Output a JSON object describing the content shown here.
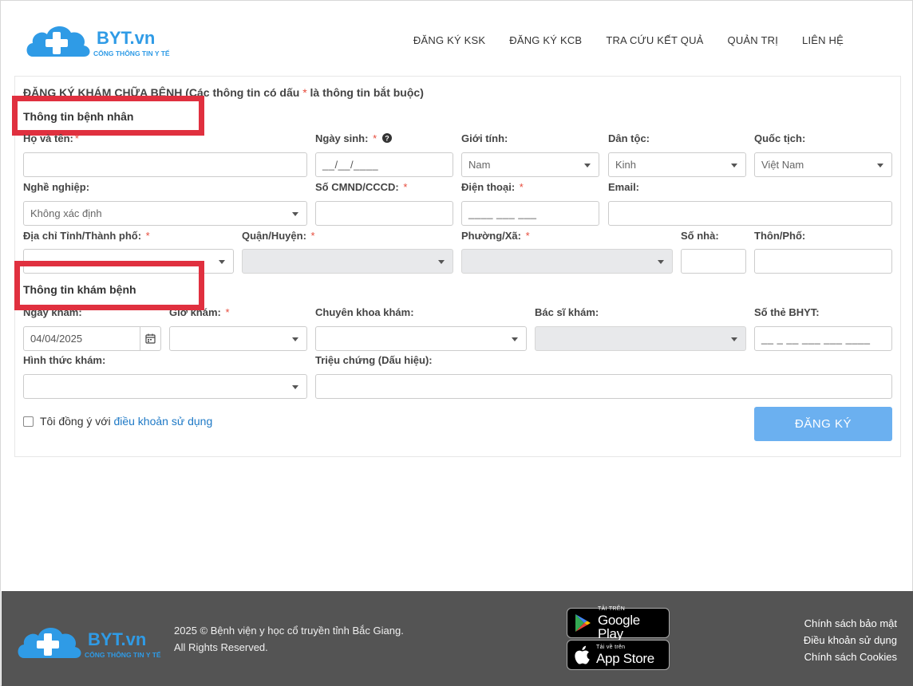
{
  "header": {
    "logo_text": "BYT.vn",
    "logo_tagline": "CỔNG THÔNG TIN Y TẾ",
    "nav": [
      "ĐĂNG KÝ KSK",
      "ĐĂNG KÝ KCB",
      "TRA CỨU KẾT QUẢ",
      "QUẢN TRỊ",
      "LIÊN HỆ"
    ]
  },
  "form": {
    "title_prefix": "ĐĂNG KÝ KHÁM CHỮA BỆNH (Các thông tin có dấu ",
    "title_asterisk": "*",
    "title_suffix": " là thông tin bắt buộc)",
    "patient_section": "Thông tin bệnh nhân",
    "exam_section": "Thông tin khám bệnh",
    "required_mark": "*",
    "labels": {
      "full_name": "Họ và tên:",
      "dob": "Ngày sinh:",
      "gender": "Giới tính:",
      "ethnicity": "Dân tộc:",
      "nationality": "Quốc tịch:",
      "occupation": "Nghề nghiệp:",
      "id_number": "Số CMND/CCCD:",
      "phone": "Điện thoại:",
      "email": "Email:",
      "province": "Địa chỉ Tỉnh/Thành phố:",
      "district": "Quận/Huyện:",
      "ward": "Phường/Xã:",
      "house_no": "Số nhà:",
      "hamlet": "Thôn/Phố:",
      "exam_date": "Ngày khám:",
      "exam_time": "Giờ khám:",
      "specialty": "Chuyên khoa khám:",
      "doctor": "Bác sĩ khám:",
      "insurance_no": "Số thẻ BHYT:",
      "exam_type": "Hình thức khám:",
      "symptoms": "Triệu chứng (Dấu hiệu):"
    },
    "values": {
      "dob_mask": "__/__/____",
      "gender": "Nam",
      "ethnicity": "Kinh",
      "nationality": "Việt Nam",
      "occupation": "Không xác định",
      "phone_mask": "____ ___ ___",
      "exam_date": "04/04/2025",
      "insurance_mask": "__ _ __ ___ ___ ____"
    },
    "agree_text": "Tôi đồng ý với ",
    "agree_link": "điều khoản sử dụng",
    "submit_label": "ĐĂNG KÝ"
  },
  "footer": {
    "logo_text": "BYT.vn",
    "logo_tagline": "CỔNG THÔNG TIN Y TẾ",
    "copyright_line1": "2025 © Bệnh viện y học cổ truyền tỉnh Bắc Giang.",
    "copyright_line2": "All Rights Reserved.",
    "google_play_small": "TẢI TRÊN",
    "google_play_big": "Google Play",
    "app_store_small": "Tải về trên",
    "app_store_big": "App Store",
    "links": [
      "Chính sách bảo mật",
      "Điều khoản sử dụng",
      "Chính sách Cookies"
    ]
  },
  "colors": {
    "accent_blue": "#1e79c6",
    "logo_blue": "#2f9be6",
    "submit_blue": "#6bb0f0",
    "required_red": "#e74c3c",
    "highlight_red": "#e0303f",
    "footer_bg": "#545454"
  }
}
